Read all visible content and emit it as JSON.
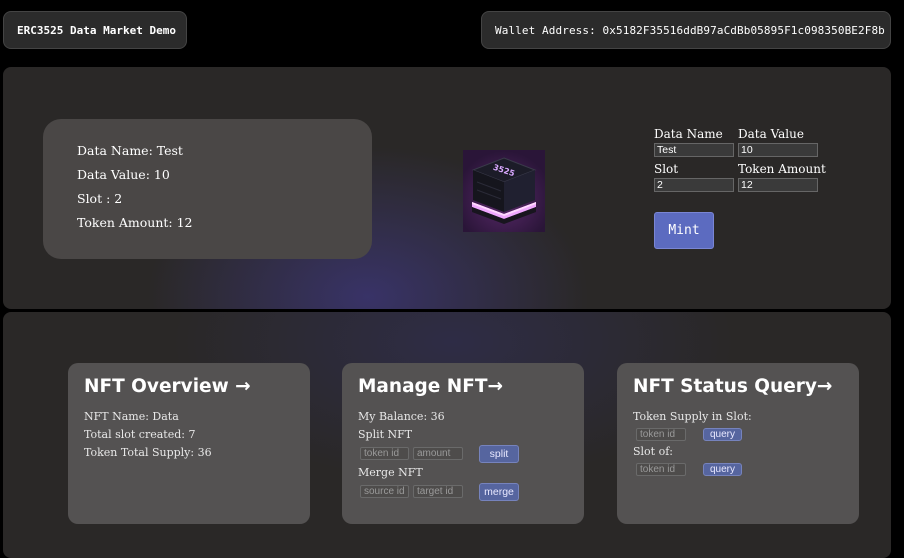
{
  "header": {
    "app_title": "ERC3525 Data Market Demo",
    "wallet_label": "Wallet Address: 0x5182F35516ddB97aCdBb05895F1c098350BE2F8b"
  },
  "mint": {
    "info": {
      "data_name": "Data Name: Test",
      "data_value": "Data Value: 10",
      "slot": "Slot : 2",
      "token_amount": "Token Amount: 12"
    },
    "image_text": "3525",
    "form": {
      "data_name_label": "Data Name",
      "data_name_value": "Test",
      "data_value_label": "Data Value",
      "data_value_value": "10",
      "slot_label": "Slot",
      "slot_value": "2",
      "token_amount_label": "Token Amount",
      "token_amount_value": "12",
      "mint_button": "Mint"
    }
  },
  "cards": {
    "overview": {
      "title": "NFT Overview →",
      "nft_name": "NFT Name: Data",
      "total_slot": "Total slot created: 7",
      "token_supply": "Token Total Supply: 36"
    },
    "manage": {
      "title": "Manage NFT→",
      "balance": "My Balance: 36",
      "split_label": "Split NFT",
      "token_id_placeholder": "token id",
      "amount_placeholder": "amount",
      "split_button": "split",
      "merge_label": "Merge NFT",
      "source_id_placeholder": "source id",
      "target_id_placeholder": "target id",
      "merge_button": "merge"
    },
    "status": {
      "title": "NFT Status Query→",
      "supply_label": "Token Supply in Slot:",
      "token_id_placeholder": "token id",
      "query_button": "query",
      "slot_of_label": "Slot of:",
      "token_id_placeholder_2": "token id",
      "query_button_2": "query"
    }
  },
  "colors": {
    "background": "#000000",
    "section": "#2a2827",
    "card": "#545252",
    "accent_button": "#5c6bc0"
  }
}
